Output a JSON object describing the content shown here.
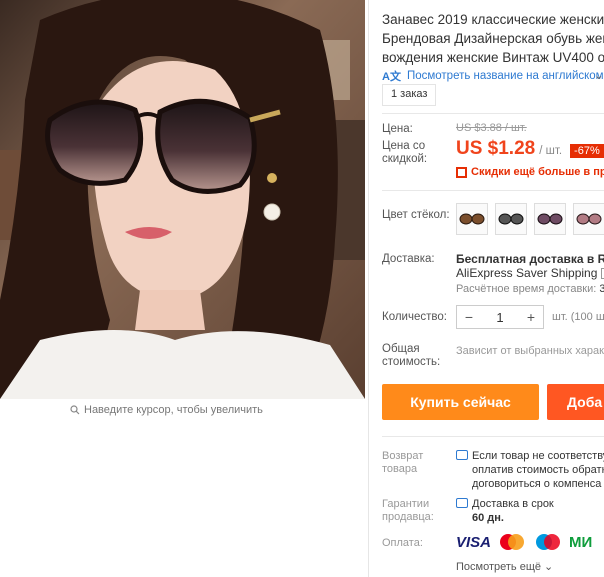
{
  "product": {
    "title_lines": [
      "Занавес 2019 классические женские",
      "Брендовая Дизайнерская обувь жен",
      "вождения женские Винтаж UV400 о"
    ],
    "translate_link": "Посмотреть название на английском",
    "orders": "1 заказ"
  },
  "image": {
    "zoom_hint": "Наведите курсор, чтобы увеличить"
  },
  "price": {
    "label": "Цена:",
    "old_price": "US $3.88 / шт.",
    "discount_label_1": "Цена со",
    "discount_label_2": "скидкой:",
    "amount": "US $1.28",
    "unit": "/ шт.",
    "percent_off": "-67%",
    "app_discount": "Скидки ещё больше в при"
  },
  "options": {
    "color_label": "Цвет стёкол:",
    "colors": [
      "brown-gradient",
      "grey-gradient",
      "purple-gradient",
      "pink-gradient"
    ]
  },
  "shipping": {
    "label": "Доставка:",
    "line1": "Бесплатная доставка в Russ",
    "line2": "AliExpress Saver Shipping",
    "line3_prefix": "Расчётное время доставки:",
    "line3_value": "3"
  },
  "quantity": {
    "label": "Количество:",
    "value": "1",
    "minus": "−",
    "plus": "+",
    "unit": "шт. (100 ш"
  },
  "total": {
    "label_1": "Общая",
    "label_2": "стоимость:",
    "value": "Зависит от выбранных харак"
  },
  "actions": {
    "buy_now": "Купить сейчас",
    "add_to_cart": "Доба"
  },
  "returns": {
    "label_1": "Возврат",
    "label_2": "товара",
    "line1": "Если товар не соответству",
    "line2": "оплатив стоимость обратн",
    "line3": "договориться о компенса"
  },
  "guarantee": {
    "label_1": "Гарантии",
    "label_2": "продавца:",
    "line1": "Доставка в срок",
    "line2": "60 дн."
  },
  "payment": {
    "label": "Оплата:",
    "visa": "VISA",
    "mir": "МИ",
    "more": "Посмотреть ещё"
  },
  "colors": {
    "accent_price": "#f0441c",
    "buy_button": "#ff8a1a",
    "cart_button": "#ff5722",
    "link": "#2e7ad1"
  }
}
